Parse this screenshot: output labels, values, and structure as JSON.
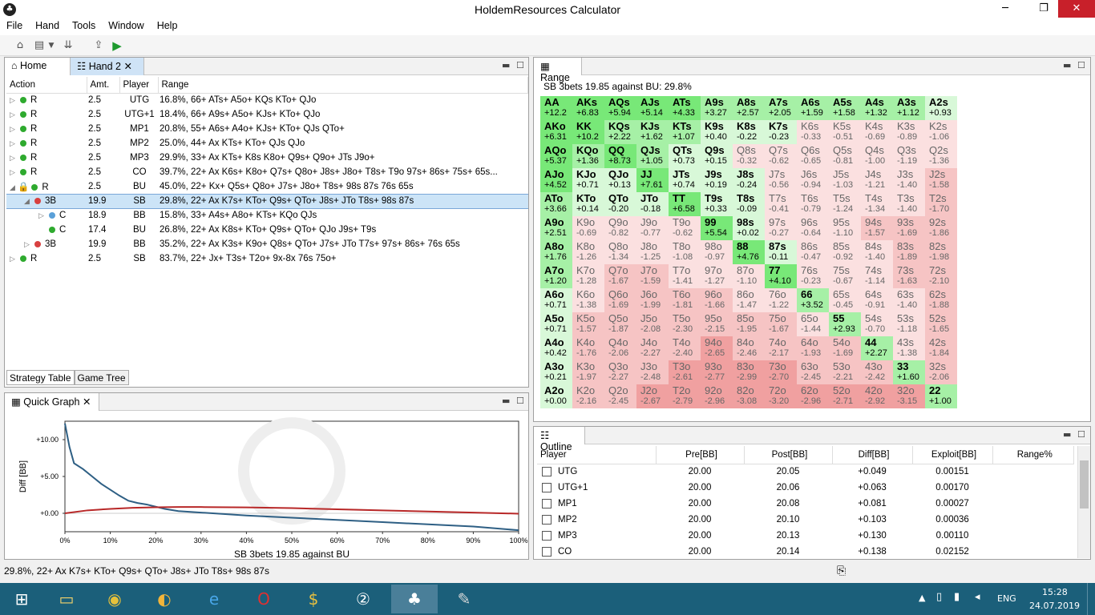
{
  "window": {
    "title": "HoldemResources Calculator"
  },
  "menu": [
    "File",
    "Hand",
    "Tools",
    "Window",
    "Help"
  ],
  "tabs": {
    "home": "Home",
    "hand2": "Hand 2",
    "range": "Range",
    "quick_graph": "Quick Graph",
    "outline": "Outline",
    "strategy_table": "Strategy Table",
    "game_tree": "Game Tree"
  },
  "strategy": {
    "headers": [
      "Action",
      "Amt.",
      "Player",
      "Range"
    ],
    "rows": [
      {
        "tri": "▷",
        "dot": "#2eaa2e",
        "action": "R",
        "amt": "2.5",
        "player": "UTG",
        "range": "16.8%, 66+ ATs+ A5o+ KQs KTo+ QJo",
        "indent": 0
      },
      {
        "tri": "▷",
        "dot": "#2eaa2e",
        "action": "R",
        "amt": "2.5",
        "player": "UTG+1",
        "range": "18.4%, 66+ A9s+ A5o+ KJs+ KTo+ QJo",
        "indent": 0
      },
      {
        "tri": "▷",
        "dot": "#2eaa2e",
        "action": "R",
        "amt": "2.5",
        "player": "MP1",
        "range": "20.8%, 55+ A6s+ A4o+ KJs+ KTo+ QJs QTo+",
        "indent": 0
      },
      {
        "tri": "▷",
        "dot": "#2eaa2e",
        "action": "R",
        "amt": "2.5",
        "player": "MP2",
        "range": "25.0%, 44+ Ax KTs+ KTo+ QJs QJo",
        "indent": 0
      },
      {
        "tri": "▷",
        "dot": "#2eaa2e",
        "action": "R",
        "amt": "2.5",
        "player": "MP3",
        "range": "29.9%, 33+ Ax KTs+ K8s K8o+ Q9s+ Q9o+ JTs J9o+",
        "indent": 0
      },
      {
        "tri": "▷",
        "dot": "#2eaa2e",
        "action": "R",
        "amt": "2.5",
        "player": "CO",
        "range": "39.7%, 22+ Ax K6s+ K8o+ Q7s+ Q8o+ J8s+ J8o+ T8s+ T9o 97s+ 86s+ 75s+ 65s...",
        "indent": 0
      },
      {
        "tri": "◢",
        "dot": "#2eaa2e",
        "action": "R",
        "amt": "2.5",
        "player": "BU",
        "range": "45.0%, 22+ Kx+ Q5s+ Q8o+ J7s+ J8o+ T8s+ 98s 87s 76s 65s",
        "indent": 0,
        "lock": true
      },
      {
        "tri": "◢",
        "dot": "#d84040",
        "action": "3B",
        "amt": "19.9",
        "player": "SB",
        "range": "29.8%, 22+ Ax K7s+ KTo+ Q9s+ QTo+ J8s+ JTo T8s+ 98s 87s",
        "indent": 1,
        "selected": true
      },
      {
        "tri": "▷",
        "dot": "#5aa0d8",
        "action": "C",
        "amt": "18.9",
        "player": "BB",
        "range": "15.8%, 33+ A4s+ A8o+ KTs+ KQo QJs",
        "indent": 2
      },
      {
        "tri": "",
        "dot": "#2eaa2e",
        "action": "C",
        "amt": "17.4",
        "player": "BU",
        "range": "26.8%, 22+ Ax K8s+ KTo+ Q9s+ QTo+ QJo J9s+ T9s",
        "indent": 2
      },
      {
        "tri": "▷",
        "dot": "#d84040",
        "action": "3B",
        "amt": "19.9",
        "player": "BB",
        "range": "35.2%, 22+ Ax K3s+ K9o+ Q8s+ QTo+ J7s+ JTo T7s+ 97s+ 86s+ 76s 65s",
        "indent": 1
      },
      {
        "tri": "▷",
        "dot": "#2eaa2e",
        "action": "R",
        "amt": "2.5",
        "player": "SB",
        "range": "83.7%, 22+ Jx+ T3s+ T2o+ 9x-8x 76s 75o+",
        "indent": 0
      }
    ]
  },
  "range": {
    "caption": "SB 3bets 19.85 against BU: 29.8%",
    "hands": [
      [
        "AA",
        "AKs",
        "AQs",
        "AJs",
        "ATs",
        "A9s",
        "A8s",
        "A7s",
        "A6s",
        "A5s",
        "A4s",
        "A3s",
        "A2s"
      ],
      [
        "AKo",
        "KK",
        "KQs",
        "KJs",
        "KTs",
        "K9s",
        "K8s",
        "K7s",
        "K6s",
        "K5s",
        "K4s",
        "K3s",
        "K2s"
      ],
      [
        "AQo",
        "KQo",
        "QQ",
        "QJs",
        "QTs",
        "Q9s",
        "Q8s",
        "Q7s",
        "Q6s",
        "Q5s",
        "Q4s",
        "Q3s",
        "Q2s"
      ],
      [
        "AJo",
        "KJo",
        "QJo",
        "JJ",
        "JTs",
        "J9s",
        "J8s",
        "J7s",
        "J6s",
        "J5s",
        "J4s",
        "J3s",
        "J2s"
      ],
      [
        "ATo",
        "KTo",
        "QTo",
        "JTo",
        "TT",
        "T9s",
        "T8s",
        "T7s",
        "T6s",
        "T5s",
        "T4s",
        "T3s",
        "T2s"
      ],
      [
        "A9o",
        "K9o",
        "Q9o",
        "J9o",
        "T9o",
        "99",
        "98s",
        "97s",
        "96s",
        "95s",
        "94s",
        "93s",
        "92s"
      ],
      [
        "A8o",
        "K8o",
        "Q8o",
        "J8o",
        "T8o",
        "98o",
        "88",
        "87s",
        "86s",
        "85s",
        "84s",
        "83s",
        "82s"
      ],
      [
        "A7o",
        "K7o",
        "Q7o",
        "J7o",
        "T7o",
        "97o",
        "87o",
        "77",
        "76s",
        "75s",
        "74s",
        "73s",
        "72s"
      ],
      [
        "A6o",
        "K6o",
        "Q6o",
        "J6o",
        "T6o",
        "96o",
        "86o",
        "76o",
        "66",
        "65s",
        "64s",
        "63s",
        "62s"
      ],
      [
        "A5o",
        "K5o",
        "Q5o",
        "J5o",
        "T5o",
        "95o",
        "85o",
        "75o",
        "65o",
        "55",
        "54s",
        "53s",
        "52s"
      ],
      [
        "A4o",
        "K4o",
        "Q4o",
        "J4o",
        "T4o",
        "94o",
        "84o",
        "74o",
        "64o",
        "54o",
        "44",
        "43s",
        "42s"
      ],
      [
        "A3o",
        "K3o",
        "Q3o",
        "J3o",
        "T3o",
        "93o",
        "83o",
        "73o",
        "63o",
        "53o",
        "43o",
        "33",
        "32s"
      ],
      [
        "A2o",
        "K2o",
        "Q2o",
        "J2o",
        "T2o",
        "92o",
        "82o",
        "72o",
        "62o",
        "52o",
        "42o",
        "32o",
        "22"
      ]
    ],
    "values": [
      [
        "+12.2",
        "+6.83",
        "+5.94",
        "+5.14",
        "+4.33",
        "+3.27",
        "+2.57",
        "+2.05",
        "+1.59",
        "+1.58",
        "+1.32",
        "+1.12",
        "+0.93"
      ],
      [
        "+6.31",
        "+10.2",
        "+2.22",
        "+1.62",
        "+1.07",
        "+0.40",
        "-0.22",
        "-0.23",
        "-0.33",
        "-0.51",
        "-0.69",
        "-0.89",
        "-1.06"
      ],
      [
        "+5.37",
        "+1.36",
        "+8.73",
        "+1.05",
        "+0.73",
        "+0.15",
        "-0.32",
        "-0.62",
        "-0.65",
        "-0.81",
        "-1.00",
        "-1.19",
        "-1.36"
      ],
      [
        "+4.52",
        "+0.71",
        "+0.13",
        "+7.61",
        "+0.74",
        "+0.19",
        "-0.24",
        "-0.56",
        "-0.94",
        "-1.03",
        "-1.21",
        "-1.40",
        "-1.58"
      ],
      [
        "+3.66",
        "+0.14",
        "-0.20",
        "-0.18",
        "+6.58",
        "+0.33",
        "-0.09",
        "-0.41",
        "-0.79",
        "-1.24",
        "-1.34",
        "-1.40",
        "-1.70"
      ],
      [
        "+2.51",
        "-0.69",
        "-0.82",
        "-0.77",
        "-0.62",
        "+5.54",
        "+0.02",
        "-0.27",
        "-0.64",
        "-1.10",
        "-1.57",
        "-1.69",
        "-1.86"
      ],
      [
        "+1.76",
        "-1.26",
        "-1.34",
        "-1.25",
        "-1.08",
        "-0.97",
        "+4.76",
        "-0.11",
        "-0.47",
        "-0.92",
        "-1.40",
        "-1.89",
        "-1.98"
      ],
      [
        "+1.20",
        "-1.28",
        "-1.67",
        "-1.59",
        "-1.41",
        "-1.27",
        "-1.10",
        "+4.10",
        "-0.23",
        "-0.67",
        "-1.14",
        "-1.63",
        "-2.10"
      ],
      [
        "+0.71",
        "-1.38",
        "-1.69",
        "-1.99",
        "-1.81",
        "-1.66",
        "-1.47",
        "-1.22",
        "+3.52",
        "-0.45",
        "-0.91",
        "-1.40",
        "-1.88"
      ],
      [
        "+0.71",
        "-1.57",
        "-1.87",
        "-2.08",
        "-2.30",
        "-2.15",
        "-1.95",
        "-1.67",
        "-1.44",
        "+2.93",
        "-0.70",
        "-1.18",
        "-1.65"
      ],
      [
        "+0.42",
        "-1.76",
        "-2.06",
        "-2.27",
        "-2.40",
        "-2.65",
        "-2.46",
        "-2.17",
        "-1.93",
        "-1.69",
        "+2.27",
        "-1.38",
        "-1.84"
      ],
      [
        "+0.21",
        "-1.97",
        "-2.27",
        "-2.48",
        "-2.61",
        "-2.77",
        "-2.99",
        "-2.70",
        "-2.45",
        "-2.21",
        "-2.42",
        "+1.60",
        "-2.06"
      ],
      [
        "+0.00",
        "-2.16",
        "-2.45",
        "-2.67",
        "-2.79",
        "-2.96",
        "-3.08",
        "-3.20",
        "-2.96",
        "-2.71",
        "-2.92",
        "-3.15",
        "+1.00"
      ]
    ],
    "in_range": [
      [
        1,
        1,
        1,
        1,
        1,
        1,
        1,
        1,
        1,
        1,
        1,
        1,
        1
      ],
      [
        1,
        1,
        1,
        1,
        1,
        1,
        1,
        1,
        0,
        0,
        0,
        0,
        0
      ],
      [
        1,
        1,
        1,
        1,
        1,
        1,
        0,
        0,
        0,
        0,
        0,
        0,
        0
      ],
      [
        1,
        1,
        1,
        1,
        1,
        1,
        1,
        0,
        0,
        0,
        0,
        0,
        0
      ],
      [
        1,
        1,
        1,
        1,
        1,
        1,
        1,
        0,
        0,
        0,
        0,
        0,
        0
      ],
      [
        1,
        0,
        0,
        0,
        0,
        1,
        1,
        0,
        0,
        0,
        0,
        0,
        0
      ],
      [
        1,
        0,
        0,
        0,
        0,
        0,
        1,
        1,
        0,
        0,
        0,
        0,
        0
      ],
      [
        1,
        0,
        0,
        0,
        0,
        0,
        0,
        1,
        0,
        0,
        0,
        0,
        0
      ],
      [
        1,
        0,
        0,
        0,
        0,
        0,
        0,
        0,
        1,
        0,
        0,
        0,
        0
      ],
      [
        1,
        0,
        0,
        0,
        0,
        0,
        0,
        0,
        0,
        1,
        0,
        0,
        0
      ],
      [
        1,
        0,
        0,
        0,
        0,
        0,
        0,
        0,
        0,
        0,
        1,
        0,
        0
      ],
      [
        1,
        0,
        0,
        0,
        0,
        0,
        0,
        0,
        0,
        0,
        0,
        1,
        0
      ],
      [
        1,
        0,
        0,
        0,
        0,
        0,
        0,
        0,
        0,
        0,
        0,
        0,
        1
      ]
    ]
  },
  "outline": {
    "headers": [
      "Player",
      "Pre[BB]",
      "Post[BB]",
      "Diff[BB]",
      "Exploit[BB]",
      "Range%"
    ],
    "rows": [
      {
        "player": "UTG",
        "pre": "20.00",
        "post": "20.05",
        "diff": "+0.049",
        "exploit": "0.00151"
      },
      {
        "player": "UTG+1",
        "pre": "20.00",
        "post": "20.06",
        "diff": "+0.063",
        "exploit": "0.00170"
      },
      {
        "player": "MP1",
        "pre": "20.00",
        "post": "20.08",
        "diff": "+0.081",
        "exploit": "0.00027"
      },
      {
        "player": "MP2",
        "pre": "20.00",
        "post": "20.10",
        "diff": "+0.103",
        "exploit": "0.00036"
      },
      {
        "player": "MP3",
        "pre": "20.00",
        "post": "20.13",
        "diff": "+0.130",
        "exploit": "0.00110"
      },
      {
        "player": "CO",
        "pre": "20.00",
        "post": "20.14",
        "diff": "+0.138",
        "exploit": "0.02152"
      }
    ]
  },
  "chart_data": {
    "type": "line",
    "title": "",
    "xlabel": "SB 3bets 19.85 against BU",
    "ylabel": "Diff [BB]",
    "x_ticks": [
      "0%",
      "10%",
      "20%",
      "30%",
      "40%",
      "50%",
      "60%",
      "70%",
      "80%",
      "90%",
      "100%"
    ],
    "y_ticks": [
      "+10.00",
      "+5.00",
      "+0.00"
    ],
    "xlim": [
      0,
      100
    ],
    "ylim": [
      -2.5,
      12.5
    ],
    "series": [
      {
        "color": "#2e5f84",
        "x": [
          0,
          1,
          2,
          4,
          6,
          8,
          10,
          12,
          14,
          16,
          18,
          20,
          22,
          25,
          30,
          35,
          40,
          50,
          60,
          70,
          80,
          90,
          100
        ],
        "y": [
          12.2,
          9,
          6.8,
          6,
          5,
          4,
          3.2,
          2.4,
          1.7,
          1.4,
          1.2,
          0.9,
          0.6,
          0.3,
          0.1,
          -0.1,
          -0.3,
          -0.6,
          -0.9,
          -1.2,
          -1.5,
          -1.8,
          -2.3
        ]
      },
      {
        "color": "#b82828",
        "x": [
          0,
          5,
          10,
          15,
          20,
          25,
          30,
          40,
          50,
          60,
          70,
          80,
          90,
          100
        ],
        "y": [
          0,
          0.4,
          0.6,
          0.75,
          0.82,
          0.85,
          0.85,
          0.8,
          0.7,
          0.55,
          0.4,
          0.25,
          0.1,
          -0.05
        ]
      }
    ]
  },
  "status": {
    "text": "29.8%, 22+ Ax K7s+ KTo+ Q9s+ QTo+ J8s+ JTo T8s+ 98s 87s"
  },
  "tray": {
    "lang": "ENG",
    "time": "15:28",
    "date": "24.07.2019"
  }
}
